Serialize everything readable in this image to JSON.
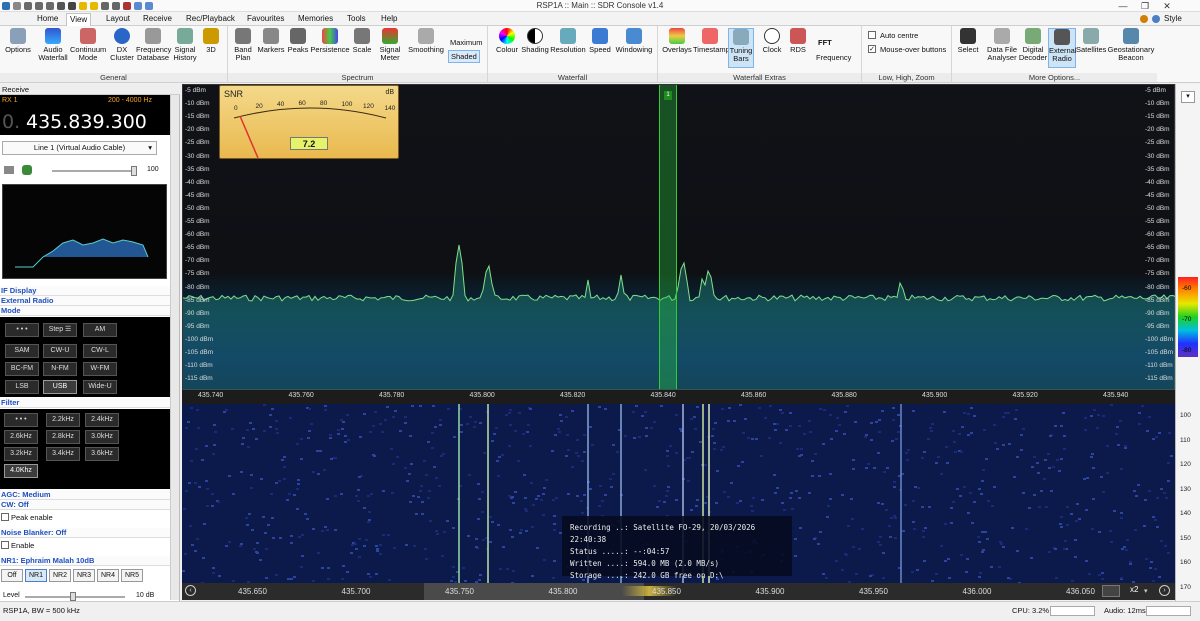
{
  "window": {
    "title": "RSP1A :: Main :: SDR Console v1.4",
    "style_label": "Style"
  },
  "menu": [
    "Home",
    "View",
    "Layout",
    "Receive",
    "Rec/Playback",
    "Favourites",
    "Memories",
    "Tools",
    "Help"
  ],
  "menu_active": "View",
  "ribbon": {
    "groups": [
      {
        "label": "General",
        "buttons": [
          "Options",
          "Audio Waterfall",
          "Continuum Mode",
          "DX Cluster",
          "Frequency Database",
          "Signal History",
          "3D"
        ]
      },
      {
        "label": "Spectrum",
        "buttons": [
          "Band Plan",
          "Markers",
          "Peaks",
          "Persistence",
          "Scale",
          "Signal Meter",
          "Smoothing"
        ],
        "extras": [
          "Maximum",
          "Shaded"
        ]
      },
      {
        "label": "Waterfall",
        "buttons": [
          "Colour",
          "Shading",
          "Resolution",
          "Speed",
          "Windowing"
        ]
      },
      {
        "label": "Waterfall Extras",
        "buttons": [
          "Overlays",
          "Timestamp",
          "Tuning Bars",
          "Clock",
          "RDS"
        ],
        "extras": [
          "FFT",
          "Frequency"
        ]
      },
      {
        "label": "Low, High, Zoom",
        "checks": [
          {
            "label": "Auto centre",
            "checked": false
          },
          {
            "label": "Mouse-over buttons",
            "checked": true
          }
        ]
      },
      {
        "label": "More Options...",
        "buttons": [
          "Select",
          "Data File Analyser",
          "Digital Decoder",
          "External Radio",
          "Satellites",
          "Geostationary Beacon"
        ]
      }
    ]
  },
  "receive": {
    "header": "Receive",
    "rx": "RX 1",
    "range": "200 - 4000 Hz",
    "frequency_dim": "0.",
    "frequency": "435.839.300",
    "audio_device": "Line 1 (Virtual Audio Cable)",
    "volume": "100",
    "volume_level": 1.0
  },
  "panels": {
    "if_display": "IF Display",
    "external_radio": "External Radio",
    "mode": "Mode",
    "filter": "Filter",
    "agc": "AGC: Medium",
    "cw": "CW: Off",
    "peak_enable": "Peak enable",
    "noise_blanker": "Noise Blanker: Off",
    "enable": "Enable",
    "nr1": "NR1: Ephraim Malah 10dB",
    "level": "Level",
    "level_value": "10 dB"
  },
  "modes": [
    "• • •",
    "Step ☰",
    "AM",
    "SAM",
    "CW-U",
    "CW-L",
    "BC-FM",
    "N-FM",
    "W-FM",
    "LSB",
    "USB",
    "Wide-U"
  ],
  "mode_selected": "USB",
  "filters": [
    "• • •",
    "2.2kHz",
    "2.4kHz",
    "2.6kHz",
    "2.8kHz",
    "3.0kHz",
    "3.2kHz",
    "3.4kHz",
    "3.6kHz",
    "4.0Khz"
  ],
  "filter_selected": "4.0Khz",
  "nr_buttons": [
    "Off",
    "NR1",
    "NR2",
    "NR3",
    "NR4",
    "NR5"
  ],
  "nr_selected": "NR1",
  "snr_meter": {
    "label": "SNR",
    "unit": "dB",
    "value": "7.2",
    "scale": [
      "0",
      "20",
      "40",
      "60",
      "80",
      "100",
      "120",
      "140"
    ]
  },
  "spectrum": {
    "db_labels": [
      "-5 dBm",
      "-10 dBm",
      "-15 dBm",
      "-20 dBm",
      "-25 dBm",
      "-30 dBm",
      "-35 dBm",
      "-40 dBm",
      "-45 dBm",
      "-50 dBm",
      "-55 dBm",
      "-60 dBm",
      "-65 dBm",
      "-70 dBm",
      "-75 dBm",
      "-80 dBm",
      "-85 dBm",
      "-90 dBm",
      "-95 dBm",
      "-100 dBm",
      "-105 dBm",
      "-110 dBm",
      "-115 dBm"
    ],
    "freq_labels": [
      "435.740",
      "435.760",
      "435.780",
      "435.800",
      "435.820",
      "435.840",
      "435.860",
      "435.880",
      "435.900",
      "435.920",
      "435.940"
    ],
    "marker": "1",
    "colorbar": [
      "-60",
      "-70",
      "-80"
    ]
  },
  "overlay": {
    "recording": "Recording ..: Satellite FO-29, 20/03/2026 22:40:38",
    "status": "Status .....: --:04:57",
    "written": "Written ....: 594.0 MB (2.0 MB/s)",
    "storage": "Storage ....: 242.0 GB free on D:\\"
  },
  "waterfall": {
    "scale": [
      "100",
      "110",
      "120",
      "130",
      "140",
      "150",
      "160",
      "170"
    ],
    "overview_labels": [
      "435.650",
      "435.700",
      "435.750",
      "435.800",
      "435.850",
      "435.900",
      "435.950",
      "436.000",
      "436.050"
    ],
    "zoom": "x2"
  },
  "status": {
    "device": "RSP1A, BW = 500 kHz",
    "cpu": "CPU: 3.2%",
    "audio": "Audio: 12ms"
  }
}
